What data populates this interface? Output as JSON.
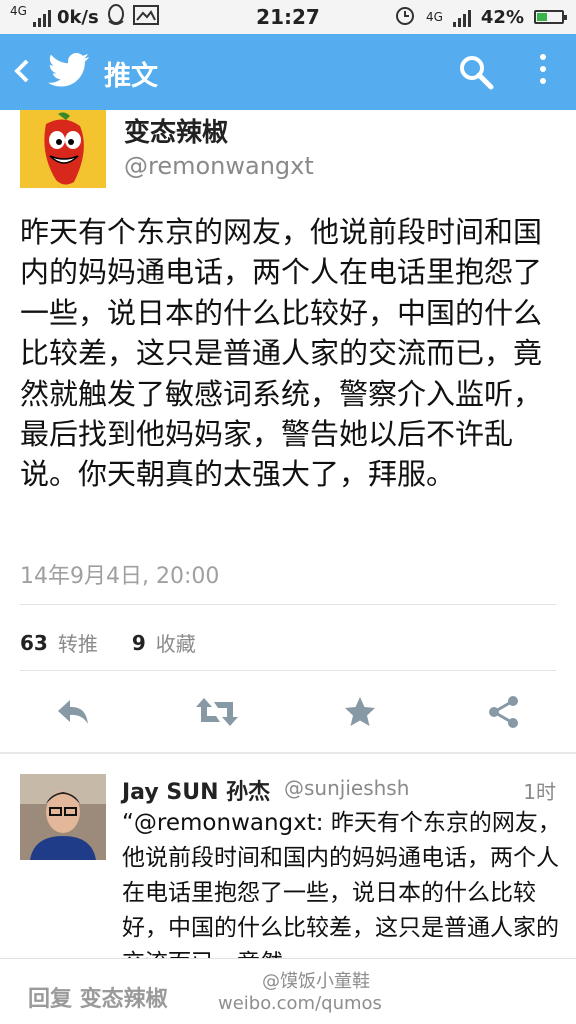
{
  "status_bar": {
    "network_left": "4G",
    "speed": "0k/s",
    "time": "21:27",
    "network_right": "4G",
    "battery": "42%",
    "battery_level": 0.42
  },
  "app_bar": {
    "title": "推文",
    "brand_color": "#55acee"
  },
  "tweet": {
    "author_name": "变态辣椒",
    "author_handle": "@remonwangxt",
    "text": "昨天有个东京的网友，他说前段时间和国内的妈妈通电话，两个人在电话里抱怨了一些，说日本的什么比较好，中国的什么比较差，这只是普通人家的交流而已，竟然就触发了敏感词系统，警察介入监听，最后找到他妈妈家，警告她以后不许乱说。你天朝真的太强大了，拜服。",
    "timestamp": "14年9月4日, 20:00",
    "retweet_count": "63",
    "retweet_label": "转推",
    "favorite_count": "9",
    "favorite_label": "收藏"
  },
  "actions": {
    "reply_icon": "reply-icon",
    "retweet_icon": "retweet-icon",
    "favorite_icon": "star-icon",
    "share_icon": "share-icon"
  },
  "reply_tweet": {
    "author_name": "Jay SUN 孙杰",
    "author_handle": "@sunjieshsh",
    "time": "1时",
    "text": "“@remonwangxt: 昨天有个东京的网友，他说前段时间和国内的妈妈通电话，两个人在电话里抱怨了一些，说日本的什么比较好，中国的什么比较差，这只是普通人家的交流而已，竟然"
  },
  "bottom_bar": {
    "reply_placeholder": "回复 变态辣椒",
    "watermark_line1": "@馍饭小童鞋",
    "watermark_line2": "weibo.com/qumos"
  }
}
